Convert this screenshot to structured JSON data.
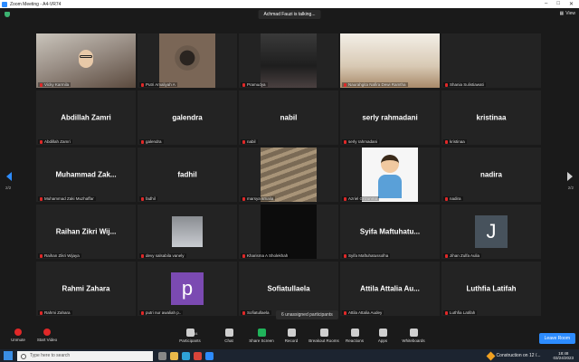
{
  "window": {
    "title": "Zoom Meeting - A4-VR74"
  },
  "topbar": {
    "talking": "Achmad Fauzi is talking...",
    "view_label": "View"
  },
  "tiles": [
    {
      "name": "",
      "caption": "Vicky Karmila",
      "video": "v-room face-glasses"
    },
    {
      "name": "",
      "caption": "Putri Amaliyah A",
      "video": "v-girl"
    },
    {
      "name": "",
      "caption": "Pramudya",
      "video": "v-dark"
    },
    {
      "name": "",
      "caption": "Naurahgita Nafira Dewi Ramtha",
      "video": "v-bed"
    },
    {
      "name": "",
      "caption": "Shania Sulistiawati",
      "video": ""
    },
    {
      "name": "Abdillah Zamri",
      "caption": "Abdillah Zamri",
      "video": ""
    },
    {
      "name": "galendra",
      "caption": "galendra",
      "video": ""
    },
    {
      "name": "nabil",
      "caption": "nabil",
      "video": ""
    },
    {
      "name": "serly rahmadani",
      "caption": "serly rahmadani",
      "video": ""
    },
    {
      "name": "kristinaa",
      "caption": "kristinaa",
      "video": ""
    },
    {
      "name": "Muhammad Zak...",
      "caption": "Muhammad Zaki Muzhaffar",
      "video": ""
    },
    {
      "name": "fadhil",
      "caption": "fadhil",
      "video": ""
    },
    {
      "name": "",
      "caption": "marsya amalia",
      "video": "v-stairs"
    },
    {
      "name": "",
      "caption": "Azriel Grizunma",
      "video": "v-cartoon"
    },
    {
      "name": "nadira",
      "caption": "nadira",
      "video": ""
    },
    {
      "name": "Raihan Zikri Wij...",
      "caption": "Raihan Zikri Wijaya",
      "video": ""
    },
    {
      "name": "",
      "caption": "devy salsabila vanely",
      "video": "v-gray"
    },
    {
      "name": "",
      "caption": "Kharisma A Sholekhah",
      "video": "v-black"
    },
    {
      "name": "Syifa Maftuhatu...",
      "caption": "Syifa Maftuhatussolha",
      "video": ""
    },
    {
      "name": "",
      "caption": "Jihan Zulfa Aulia",
      "video": "letter-J"
    },
    {
      "name": "Rahmi Zahara",
      "caption": "Rahmi Zahara",
      "video": ""
    },
    {
      "name": "",
      "caption": "putri nur awaliah p..",
      "video": "letter-p"
    },
    {
      "name": "Sofiatullaela",
      "caption": "Sofiatullaela",
      "video": ""
    },
    {
      "name": "Attila Attalia Au...",
      "caption": "Attila Attalia Audey",
      "video": ""
    },
    {
      "name": "Luthfia Latifah",
      "caption": "Luthfia Latifah",
      "video": ""
    }
  ],
  "pagination": {
    "left": "2/2",
    "right": "2/2"
  },
  "unassigned": "6 unassigned participants",
  "toolbar": {
    "unmute": "Unmute",
    "start_video": "Start Video",
    "participants": "Participants",
    "participants_count": "34",
    "chat": "Chat",
    "share_screen": "Share Screen",
    "record": "Record",
    "breakout_rooms": "Breakout Rooms",
    "reactions": "Reactions",
    "apps": "Apps",
    "whiteboards": "Whiteboards",
    "leave": "Leave Room"
  },
  "taskbar": {
    "search_placeholder": "Type here to search",
    "notification": "Construction on 12 /...",
    "time": "18:48",
    "date": "03/24/2023"
  },
  "colors": {
    "accent": "#2d8cff",
    "share": "#20b35a",
    "muted": "#e02828"
  }
}
